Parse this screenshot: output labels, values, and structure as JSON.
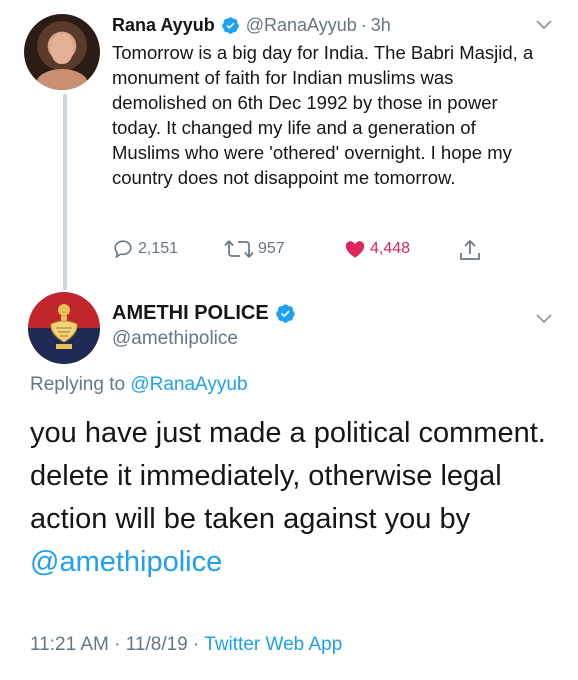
{
  "tweet1": {
    "author_name": "Rana Ayyub",
    "author_handle": "@RanaAyyub",
    "separator": "·",
    "time": "3h",
    "text": "Tomorrow is a big day for India. The Babri Masjid, a monument of faith for Indian muslims was demolished on 6th Dec 1992 by those in power today. It changed my life and a generation of Muslims who were 'othered' overnight. I hope my country does not disappoint me tomorrow.",
    "replies": "2,151",
    "retweets": "957",
    "likes": "4,448"
  },
  "tweet2": {
    "author_name": "AMETHI POLICE",
    "author_handle": "@amethipolice",
    "replying_prefix": "Replying to",
    "replying_to": "@RanaAyyub",
    "text": "you have just made a political comment. delete it immediately, otherwise legal action will be taken against you by",
    "mention": "@amethipolice",
    "timestamp": "11:21 AM · 11/8/19 ·",
    "source": "Twitter Web App"
  },
  "colors": {
    "accent": "#1da1f2",
    "secondary_text": "#657786",
    "like": "#e0245e"
  },
  "icons": [
    "verified-badge-icon",
    "chevron-down-icon",
    "reply-icon",
    "retweet-icon",
    "heart-icon",
    "share-icon"
  ]
}
